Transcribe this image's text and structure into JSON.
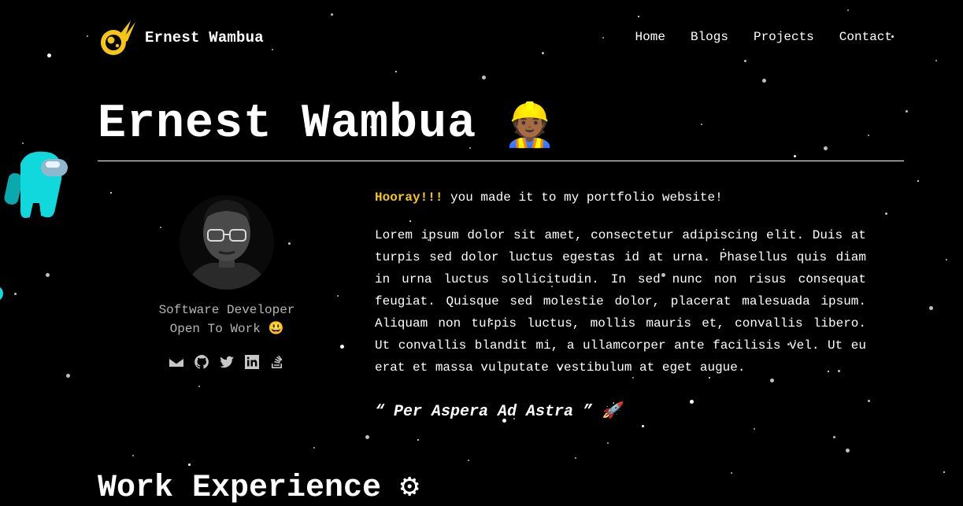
{
  "brand": {
    "name": "Ernest Wambua",
    "logo": "comet-icon"
  },
  "nav": {
    "items": [
      "Home",
      "Blogs",
      "Projects",
      "Contact"
    ]
  },
  "hero": {
    "title": "Ernest Wambua",
    "emoji": "👷🏾"
  },
  "profile": {
    "role": "Software Developer",
    "status": "Open To Work 😃",
    "social_icons": [
      "email-icon",
      "github-icon",
      "twitter-icon",
      "linkedin-icon",
      "stackoverflow-icon"
    ]
  },
  "intro": {
    "highlight": "Hooray!!!",
    "rest": " you made it to my portfolio website!"
  },
  "about": "Lorem ipsum dolor sit amet, consectetur adipiscing elit. Duis at turpis sed dolor luctus egestas id at urna. Phasellus quis diam in urna luctus sollicitudin. In sed nunc non risus consequat feugiat. Quisque sed molestie dolor, placerat malesuada ipsum. Aliquam non turpis luctus, mollis mauris et, convallis libero. Ut convallis blandit mi, a ullamcorper ante facilisis vel. Ut eu erat et massa vulputate vestibulum at eget augue.",
  "quote": "“ Per Aspera Ad Astra ” 🚀",
  "sections": {
    "work_title": "Work Experience"
  },
  "colors": {
    "accent": "#f5c518",
    "background": "#000000",
    "text": "#ffffff",
    "muted": "#b5b5b5"
  }
}
